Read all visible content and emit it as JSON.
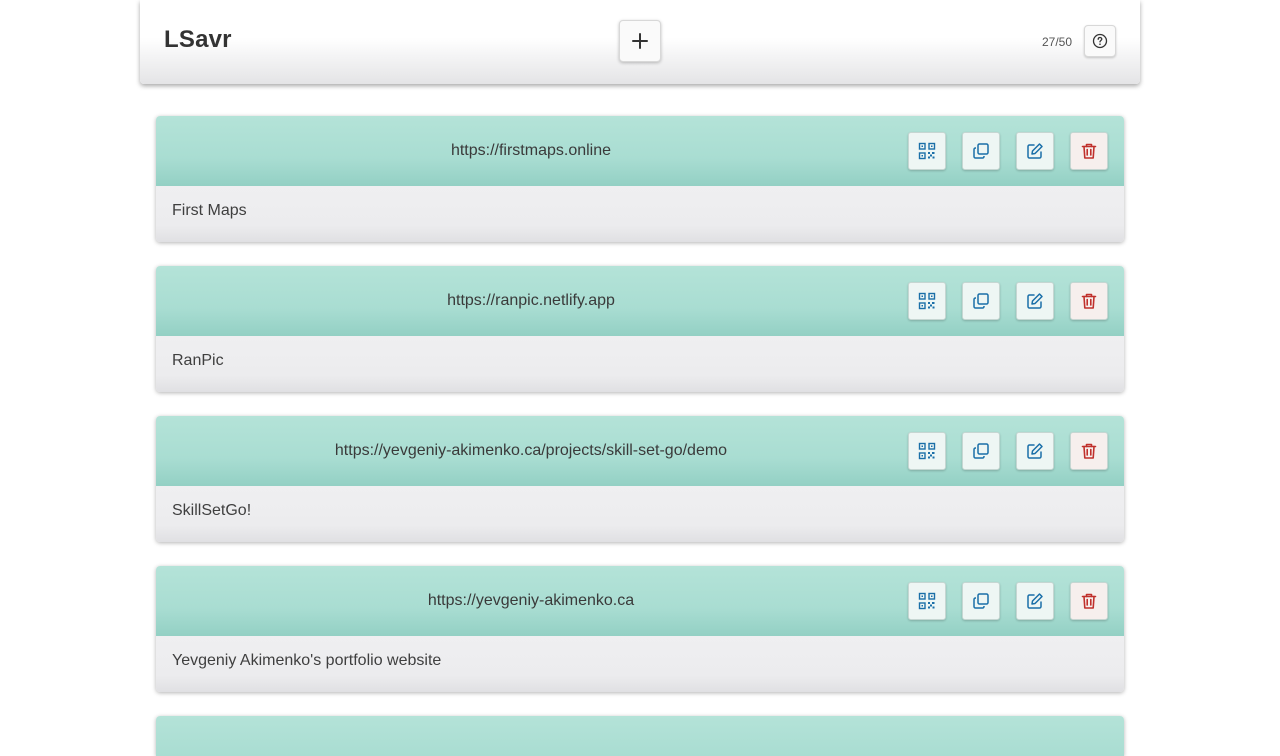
{
  "header": {
    "title": "LSavr",
    "counter": "27/50"
  },
  "icons": {
    "add": "plus-icon",
    "help": "question-circle-icon",
    "qr": "qr-code-icon",
    "copy": "copy-icon",
    "edit": "edit-icon",
    "delete": "trash-icon"
  },
  "colors": {
    "card_header": "#aadfd3",
    "icon_blue": "#1a6fa8",
    "icon_red": "#c0302c"
  },
  "links": [
    {
      "url": "https://firstmaps.online",
      "description": "First Maps"
    },
    {
      "url": "https://ranpic.netlify.app",
      "description": "RanPic"
    },
    {
      "url": "https://yevgeniy-akimenko.ca/projects/skill-set-go/demo",
      "description": "SkillSetGo!"
    },
    {
      "url": "https://yevgeniy-akimenko.ca",
      "description": "Yevgeniy Akimenko's portfolio website"
    }
  ]
}
